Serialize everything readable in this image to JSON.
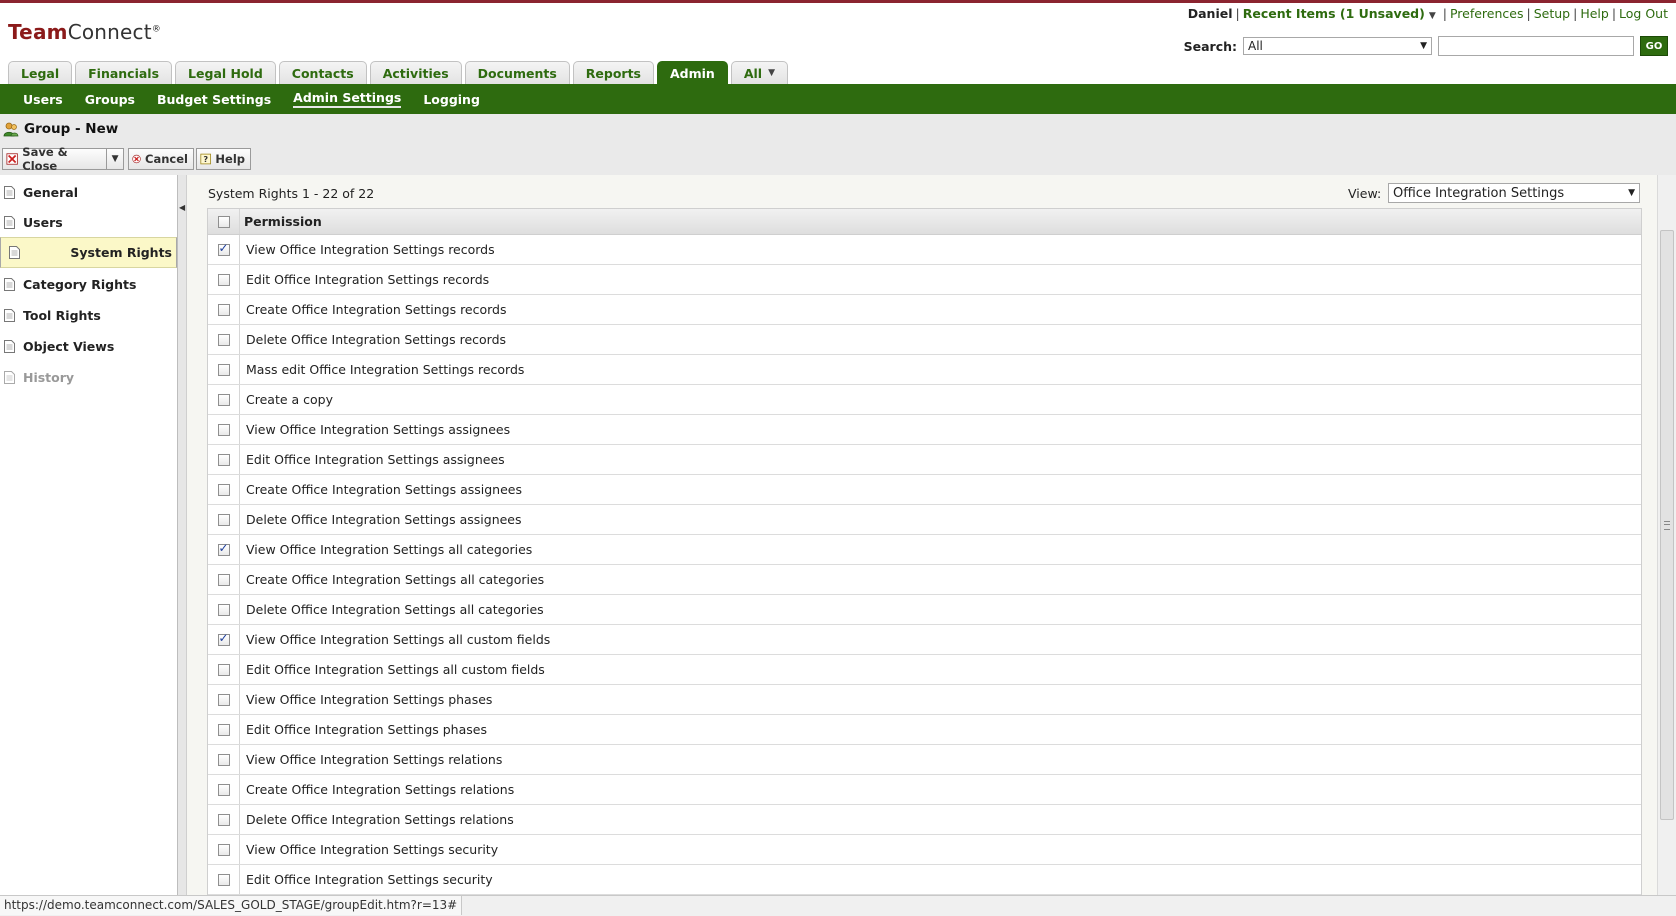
{
  "app": {
    "logo_bold": "Team",
    "logo_rest": "Connect",
    "logo_mark": "®"
  },
  "header": {
    "user": "Daniel",
    "recent_items": "Recent Items (1 Unsaved)",
    "preferences": "Preferences",
    "setup": "Setup",
    "help": "Help",
    "logout": "Log Out",
    "search_label": "Search:",
    "search_scope": "All",
    "search_value": "",
    "go_label": "GO"
  },
  "tabs": [
    {
      "label": "Legal"
    },
    {
      "label": "Financials"
    },
    {
      "label": "Legal Hold"
    },
    {
      "label": "Contacts"
    },
    {
      "label": "Activities"
    },
    {
      "label": "Documents"
    },
    {
      "label": "Reports"
    },
    {
      "label": "Admin",
      "active": true
    },
    {
      "label": "All"
    }
  ],
  "subnav": [
    {
      "label": "Users"
    },
    {
      "label": "Groups"
    },
    {
      "label": "Budget Settings"
    },
    {
      "label": "Admin Settings",
      "current": true
    },
    {
      "label": "Logging"
    }
  ],
  "page": {
    "title": "Group - New"
  },
  "toolbar": {
    "save_close": "Save & Close",
    "cancel": "Cancel",
    "help": "Help"
  },
  "sidebar": {
    "items": [
      {
        "label": "General"
      },
      {
        "label": "Users"
      },
      {
        "label": "System Rights",
        "selected": true
      },
      {
        "label": "Category Rights"
      },
      {
        "label": "Tool Rights"
      },
      {
        "label": "Object Views"
      },
      {
        "label": "History",
        "disabled": true
      }
    ]
  },
  "rights": {
    "summary": "System Rights 1 - 22 of 22",
    "view_label": "View:",
    "view_value": "Office Integration Settings",
    "column_header": "Permission",
    "rows": [
      {
        "label": "View Office Integration Settings records",
        "checked": true
      },
      {
        "label": "Edit Office Integration Settings records",
        "checked": false
      },
      {
        "label": "Create Office Integration Settings records",
        "checked": false
      },
      {
        "label": "Delete Office Integration Settings records",
        "checked": false
      },
      {
        "label": "Mass edit Office Integration Settings records",
        "checked": false
      },
      {
        "label": "Create a copy",
        "checked": false
      },
      {
        "label": "View Office Integration Settings assignees",
        "checked": false
      },
      {
        "label": "Edit Office Integration Settings assignees",
        "checked": false
      },
      {
        "label": "Create Office Integration Settings assignees",
        "checked": false
      },
      {
        "label": "Delete Office Integration Settings assignees",
        "checked": false
      },
      {
        "label": "View Office Integration Settings all categories",
        "checked": true
      },
      {
        "label": "Create Office Integration Settings all categories",
        "checked": false
      },
      {
        "label": "Delete Office Integration Settings all categories",
        "checked": false
      },
      {
        "label": "View Office Integration Settings all custom fields",
        "checked": true
      },
      {
        "label": "Edit Office Integration Settings all custom fields",
        "checked": false
      },
      {
        "label": "View Office Integration Settings phases",
        "checked": false
      },
      {
        "label": "Edit Office Integration Settings phases",
        "checked": false
      },
      {
        "label": "View Office Integration Settings relations",
        "checked": false
      },
      {
        "label": "Create Office Integration Settings relations",
        "checked": false
      },
      {
        "label": "Delete Office Integration Settings relations",
        "checked": false
      },
      {
        "label": "View Office Integration Settings security",
        "checked": false
      },
      {
        "label": "Edit Office Integration Settings security",
        "checked": false
      }
    ]
  },
  "statusbar": {
    "url": "https://demo.teamconnect.com/SALES_GOLD_STAGE/groupEdit.htm?r=13#"
  },
  "icons": {
    "group": "group-icon",
    "save": "save-icon",
    "cancel": "cancel-icon",
    "help": "help-icon",
    "document": "document-icon"
  },
  "colors": {
    "brand_green": "#2e6b0f",
    "selected_row": "#fbf8c8",
    "logo_red": "#8b1a1a"
  }
}
